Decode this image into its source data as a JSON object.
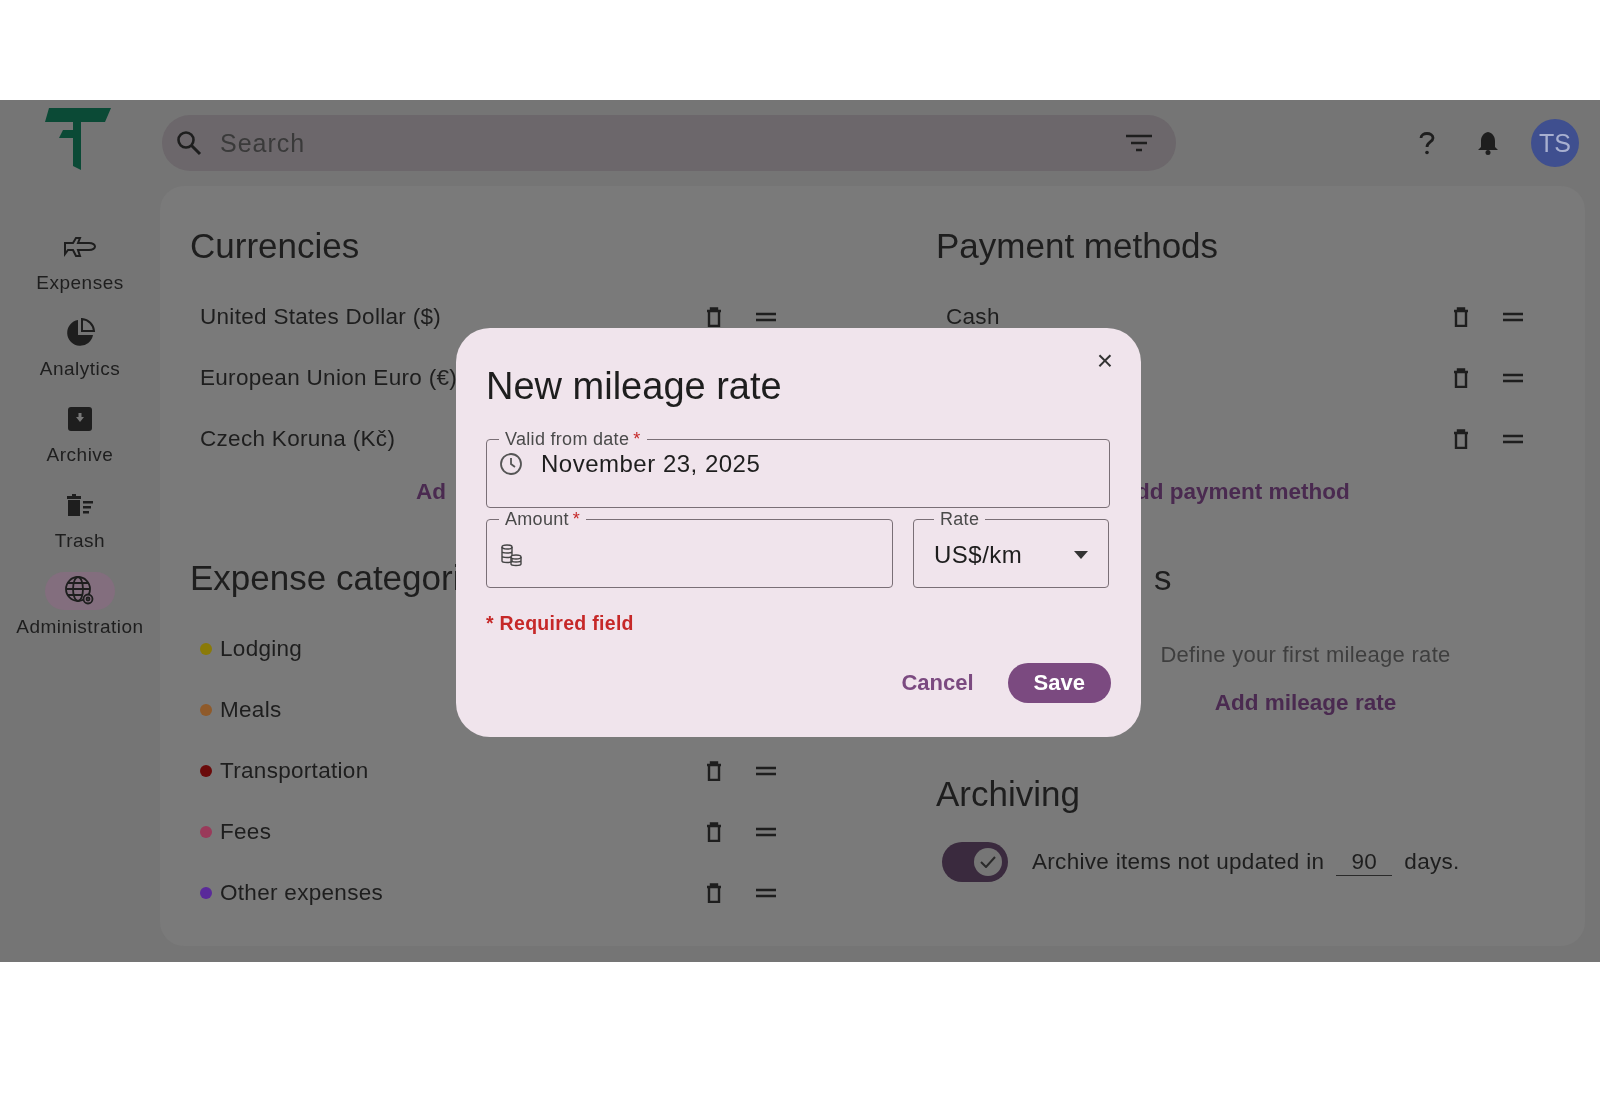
{
  "app_bar": {
    "search": {
      "placeholder": "Search"
    },
    "avatar": {
      "initials": "TS"
    }
  },
  "nav": [
    {
      "label": "Expenses",
      "selected": false
    },
    {
      "label": "Analytics",
      "selected": false
    },
    {
      "label": "Archive",
      "selected": false
    },
    {
      "label": "Trash",
      "selected": false
    },
    {
      "label": "Administration",
      "selected": true
    }
  ],
  "currencies": {
    "title": "Currencies",
    "items": [
      {
        "name": "United States Dollar ($)",
        "actions": true
      },
      {
        "name": "European Union Euro (€)"
      },
      {
        "name": "Czech Koruna (Kč)"
      }
    ],
    "add_link": "Ad"
  },
  "expense_categories": {
    "title": "Expense categori",
    "items": [
      {
        "name": "Lodging",
        "color": "#8a7a08"
      },
      {
        "name": "Meals",
        "color": "#8f5a2a"
      },
      {
        "name": "Transportation",
        "color": "#6a0a0a",
        "actions": true
      },
      {
        "name": "Fees",
        "color": "#9a3a5a",
        "actions": true
      },
      {
        "name": "Other expenses",
        "color": "#5a2a9a",
        "actions": true
      }
    ]
  },
  "payment_methods": {
    "title": "Payment methods",
    "items": [
      {
        "name": "Cash",
        "actions": true
      },
      {
        "actions": true
      },
      {
        "actions": true
      }
    ],
    "add_link": "dd payment method"
  },
  "mileage_rates": {
    "title": "s",
    "empty_text": "Define your first mileage rate",
    "add_link": "Add mileage rate"
  },
  "archiving": {
    "title": "Archiving",
    "enabled": true,
    "text_before": "Archive items not updated in",
    "days": "90",
    "text_after": "days."
  },
  "dialog": {
    "title": "New mileage rate",
    "close": "×",
    "fields": [
      {
        "kind": "date",
        "label": "Valid from date",
        "required_mark": "*",
        "value": "November 23, 2025"
      },
      {
        "kind": "amount",
        "label": "Amount",
        "required_mark": "*"
      },
      {
        "kind": "select",
        "label": "Rate",
        "value": "US$/km"
      }
    ],
    "required_note": "* Required field",
    "buttons": [
      {
        "kind": "text",
        "label": "Cancel"
      },
      {
        "kind": "filled",
        "label": "Save"
      }
    ]
  }
}
